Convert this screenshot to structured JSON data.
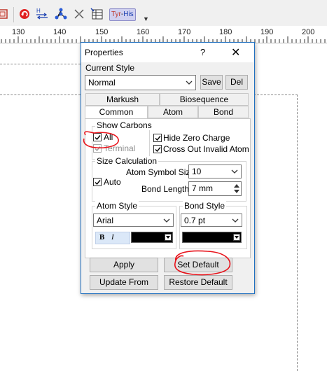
{
  "toolbar": {
    "icons": [
      "frame-icon",
      "rotate-icon",
      "hydrogen-swap-icon",
      "molecule-icon",
      "clear-structure-icon",
      "table-icon"
    ],
    "sequence_labels": [
      "Tyr",
      "His"
    ]
  },
  "ruler": {
    "ticks": [
      "130",
      "140",
      "150",
      "160",
      "170",
      "180",
      "190",
      "200"
    ]
  },
  "dialog": {
    "title": "Properties",
    "help": "?",
    "close": "✕",
    "current_style_label": "Current Style",
    "current_style_value": "Normal",
    "save_label": "Save",
    "del_label": "Del",
    "tabs_row1": [
      "Markush",
      "Biosequence"
    ],
    "tabs_row2": [
      "Common",
      "Atom",
      "Bond"
    ],
    "active_tab": "Common",
    "show_carbons": {
      "title": "Show Carbons",
      "all_label": "All",
      "all_checked": true,
      "terminal_label": "Terminal",
      "terminal_checked": true,
      "terminal_disabled": true,
      "hide_zero_label": "Hide Zero Charge",
      "hide_zero_checked": true,
      "cross_out_label": "Cross Out Invalid Atom",
      "cross_out_checked": true
    },
    "size_calc": {
      "title": "Size Calculation",
      "auto_label": "Auto",
      "auto_checked": true,
      "atom_symbol_label": "Atom Symbol Size",
      "atom_symbol_value": "10",
      "bond_length_label": "Bond Length",
      "bond_length_value": "7 mm"
    },
    "atom_style": {
      "title": "Atom Style",
      "font": "Arial",
      "bold": "B",
      "italic": "I",
      "color": "#000000"
    },
    "bond_style": {
      "title": "Bond Style",
      "width": "0.7 pt",
      "color": "#000000"
    },
    "apply_label": "Apply",
    "set_default_label": "Set Default",
    "update_from_label": "Update From",
    "restore_default_label": "Restore Default"
  },
  "annotations": {
    "color": "#e8141c"
  }
}
